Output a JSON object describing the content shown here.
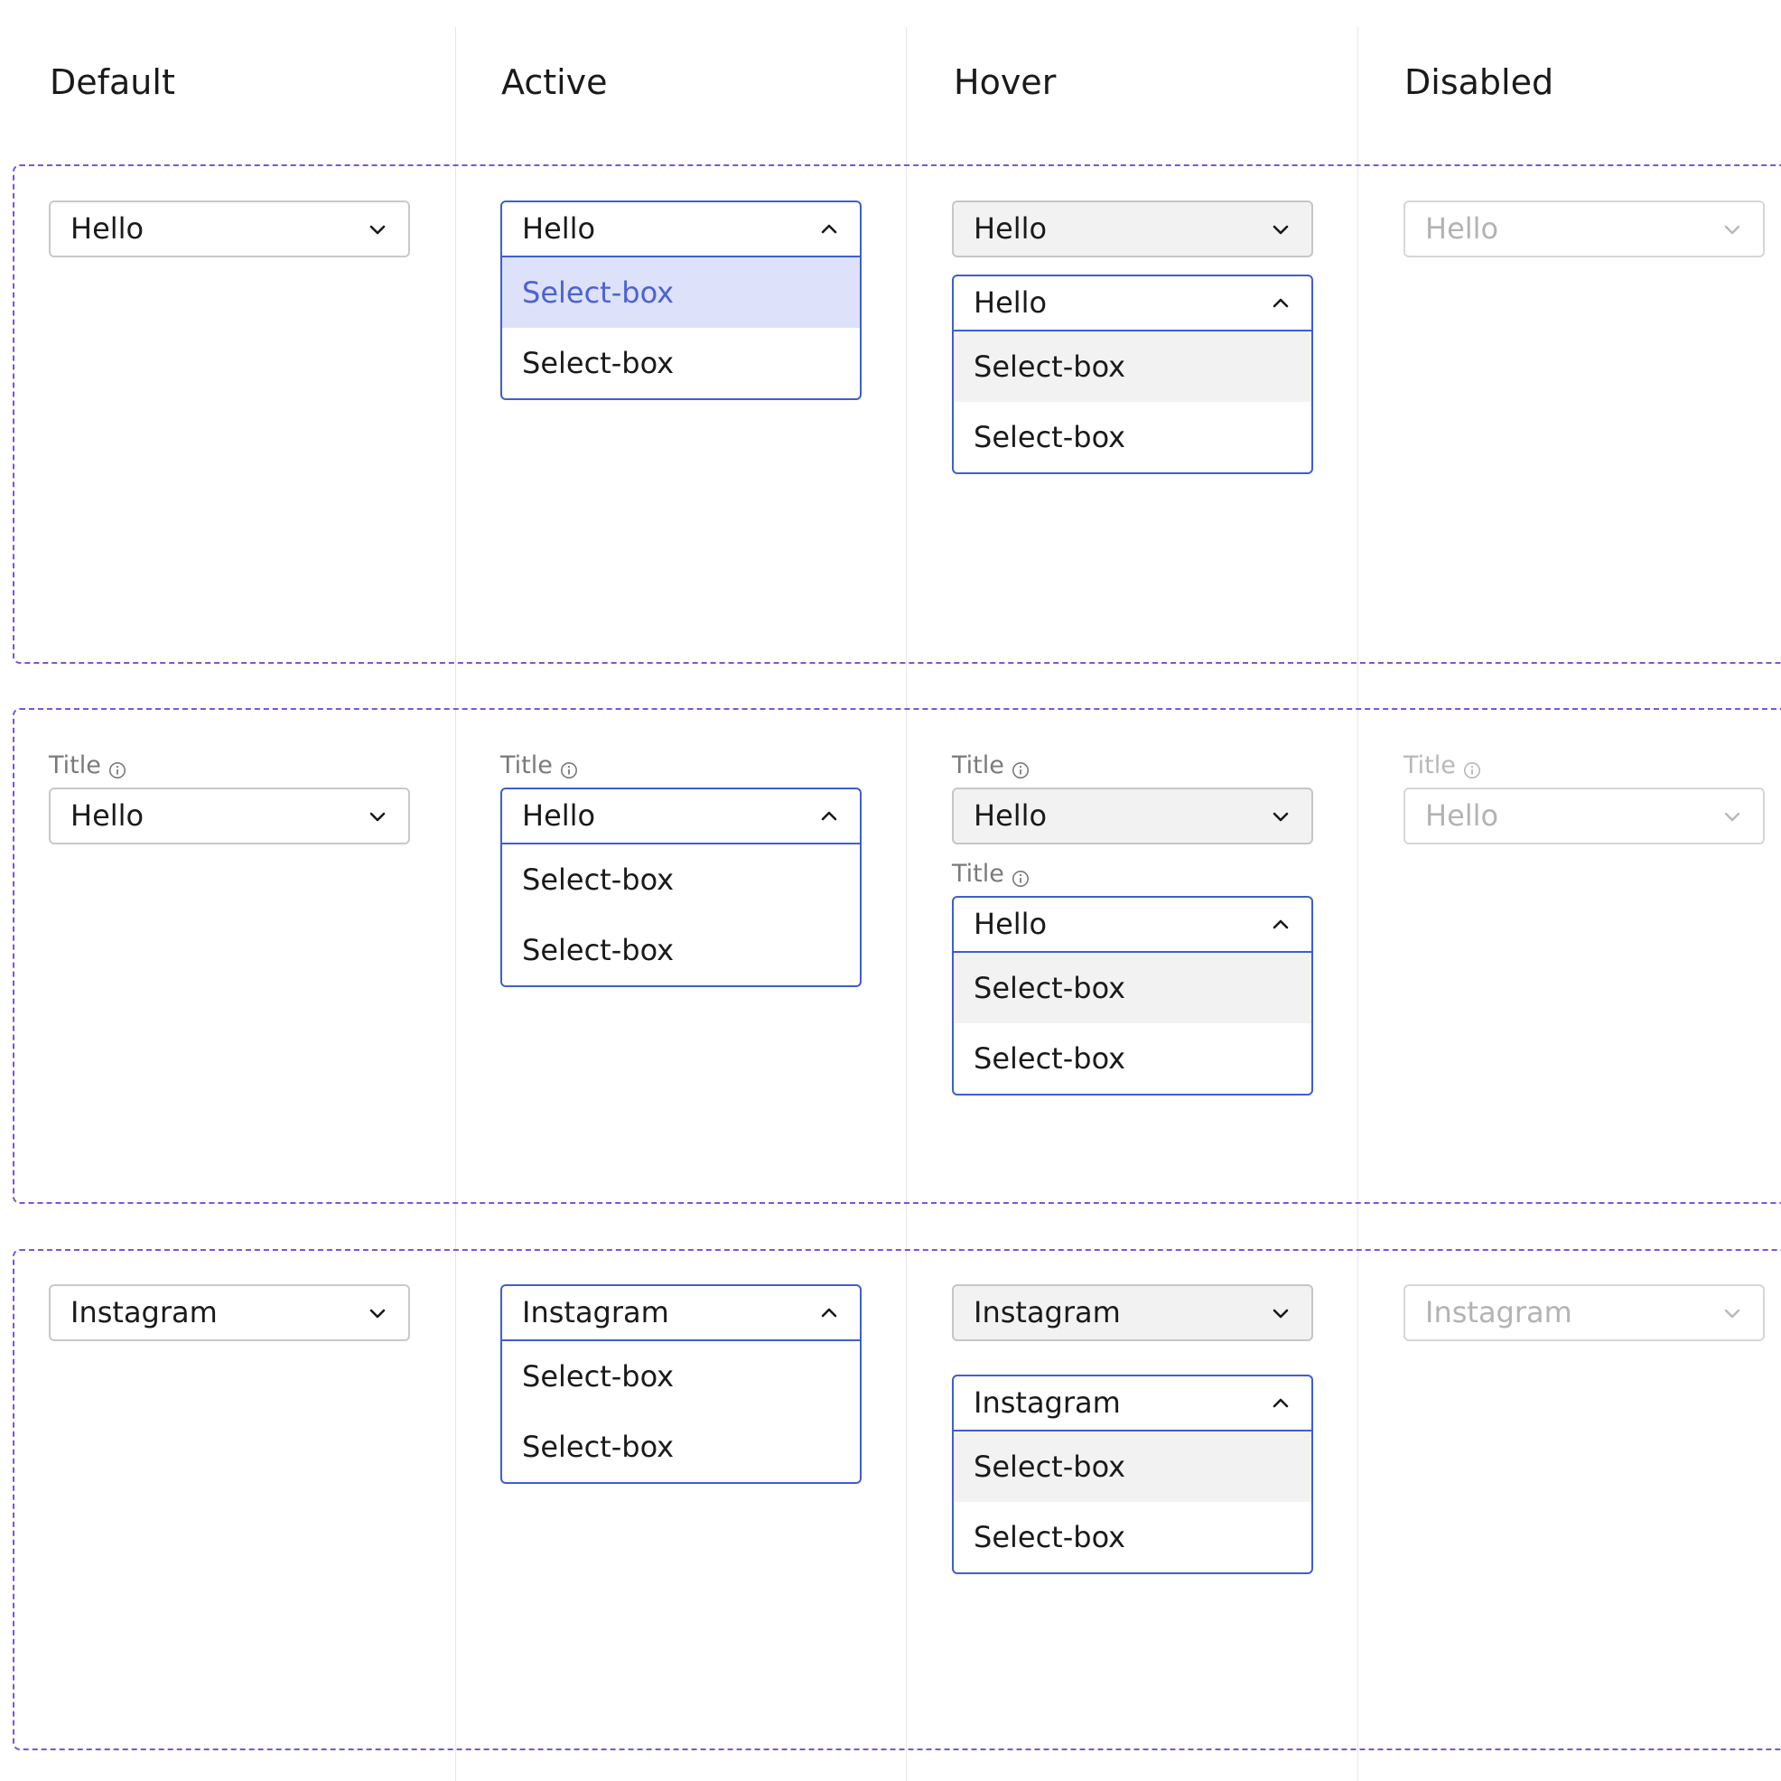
{
  "columns": [
    {
      "header": "Default"
    },
    {
      "header": "Active"
    },
    {
      "header": "Hover"
    },
    {
      "header": "Disabled"
    }
  ],
  "colors": {
    "section_border": "#7a55d8",
    "active_border": "#3f5ecf",
    "selected_bg": "#dde1fa",
    "selected_text": "#4b63cf",
    "hover_bg": "#f2f2f2",
    "disabled_text": "#b3b3b3"
  },
  "icons": {
    "closed": "chevron-down-icon",
    "open": "chevron-up-icon",
    "info": "info-icon"
  },
  "section1": {
    "default": {
      "value": "Hello"
    },
    "active": {
      "value": "Hello",
      "options": [
        "Select-box",
        "Select-box"
      ]
    },
    "hover": {
      "value": "Hello"
    },
    "hover_open": {
      "value": "Hello",
      "options": [
        "Select-box",
        "Select-box"
      ]
    },
    "disabled": {
      "value": "Hello"
    }
  },
  "section2": {
    "default": {
      "title": "Title",
      "value": "Hello"
    },
    "active": {
      "title": "Title",
      "value": "Hello",
      "options": [
        "Select-box",
        "Select-box"
      ]
    },
    "hover": {
      "title": "Title",
      "value": "Hello"
    },
    "hover_open": {
      "title": "Title",
      "value": "Hello",
      "options": [
        "Select-box",
        "Select-box"
      ]
    },
    "disabled": {
      "title": "Title",
      "value": "Hello"
    }
  },
  "section3": {
    "default": {
      "value": "Instagram"
    },
    "active": {
      "value": "Instagram",
      "options": [
        "Select-box",
        "Select-box"
      ]
    },
    "hover": {
      "value": "Instagram"
    },
    "hover_open": {
      "value": "Instagram",
      "options": [
        "Select-box",
        "Select-box"
      ]
    },
    "disabled": {
      "value": "Instagram"
    }
  }
}
